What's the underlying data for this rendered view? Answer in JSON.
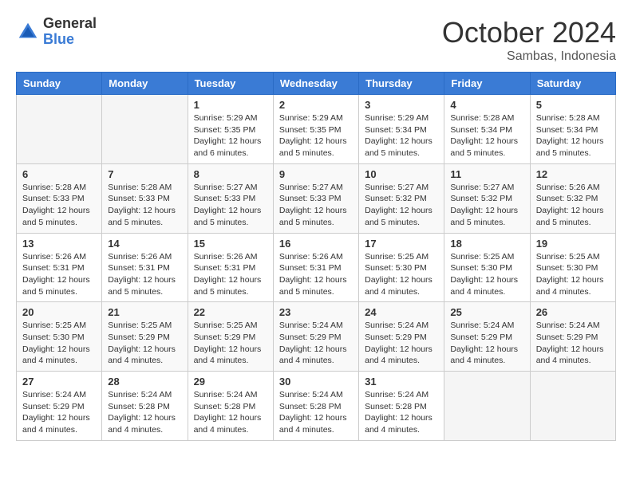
{
  "header": {
    "logo_general": "General",
    "logo_blue": "Blue",
    "month_title": "October 2024",
    "subtitle": "Sambas, Indonesia"
  },
  "days_of_week": [
    "Sunday",
    "Monday",
    "Tuesday",
    "Wednesday",
    "Thursday",
    "Friday",
    "Saturday"
  ],
  "weeks": [
    [
      {
        "day": "",
        "info": ""
      },
      {
        "day": "",
        "info": ""
      },
      {
        "day": "1",
        "info": "Sunrise: 5:29 AM\nSunset: 5:35 PM\nDaylight: 12 hours and 6 minutes."
      },
      {
        "day": "2",
        "info": "Sunrise: 5:29 AM\nSunset: 5:35 PM\nDaylight: 12 hours and 5 minutes."
      },
      {
        "day": "3",
        "info": "Sunrise: 5:29 AM\nSunset: 5:34 PM\nDaylight: 12 hours and 5 minutes."
      },
      {
        "day": "4",
        "info": "Sunrise: 5:28 AM\nSunset: 5:34 PM\nDaylight: 12 hours and 5 minutes."
      },
      {
        "day": "5",
        "info": "Sunrise: 5:28 AM\nSunset: 5:34 PM\nDaylight: 12 hours and 5 minutes."
      }
    ],
    [
      {
        "day": "6",
        "info": "Sunrise: 5:28 AM\nSunset: 5:33 PM\nDaylight: 12 hours and 5 minutes."
      },
      {
        "day": "7",
        "info": "Sunrise: 5:28 AM\nSunset: 5:33 PM\nDaylight: 12 hours and 5 minutes."
      },
      {
        "day": "8",
        "info": "Sunrise: 5:27 AM\nSunset: 5:33 PM\nDaylight: 12 hours and 5 minutes."
      },
      {
        "day": "9",
        "info": "Sunrise: 5:27 AM\nSunset: 5:33 PM\nDaylight: 12 hours and 5 minutes."
      },
      {
        "day": "10",
        "info": "Sunrise: 5:27 AM\nSunset: 5:32 PM\nDaylight: 12 hours and 5 minutes."
      },
      {
        "day": "11",
        "info": "Sunrise: 5:27 AM\nSunset: 5:32 PM\nDaylight: 12 hours and 5 minutes."
      },
      {
        "day": "12",
        "info": "Sunrise: 5:26 AM\nSunset: 5:32 PM\nDaylight: 12 hours and 5 minutes."
      }
    ],
    [
      {
        "day": "13",
        "info": "Sunrise: 5:26 AM\nSunset: 5:31 PM\nDaylight: 12 hours and 5 minutes."
      },
      {
        "day": "14",
        "info": "Sunrise: 5:26 AM\nSunset: 5:31 PM\nDaylight: 12 hours and 5 minutes."
      },
      {
        "day": "15",
        "info": "Sunrise: 5:26 AM\nSunset: 5:31 PM\nDaylight: 12 hours and 5 minutes."
      },
      {
        "day": "16",
        "info": "Sunrise: 5:26 AM\nSunset: 5:31 PM\nDaylight: 12 hours and 5 minutes."
      },
      {
        "day": "17",
        "info": "Sunrise: 5:25 AM\nSunset: 5:30 PM\nDaylight: 12 hours and 4 minutes."
      },
      {
        "day": "18",
        "info": "Sunrise: 5:25 AM\nSunset: 5:30 PM\nDaylight: 12 hours and 4 minutes."
      },
      {
        "day": "19",
        "info": "Sunrise: 5:25 AM\nSunset: 5:30 PM\nDaylight: 12 hours and 4 minutes."
      }
    ],
    [
      {
        "day": "20",
        "info": "Sunrise: 5:25 AM\nSunset: 5:30 PM\nDaylight: 12 hours and 4 minutes."
      },
      {
        "day": "21",
        "info": "Sunrise: 5:25 AM\nSunset: 5:29 PM\nDaylight: 12 hours and 4 minutes."
      },
      {
        "day": "22",
        "info": "Sunrise: 5:25 AM\nSunset: 5:29 PM\nDaylight: 12 hours and 4 minutes."
      },
      {
        "day": "23",
        "info": "Sunrise: 5:24 AM\nSunset: 5:29 PM\nDaylight: 12 hours and 4 minutes."
      },
      {
        "day": "24",
        "info": "Sunrise: 5:24 AM\nSunset: 5:29 PM\nDaylight: 12 hours and 4 minutes."
      },
      {
        "day": "25",
        "info": "Sunrise: 5:24 AM\nSunset: 5:29 PM\nDaylight: 12 hours and 4 minutes."
      },
      {
        "day": "26",
        "info": "Sunrise: 5:24 AM\nSunset: 5:29 PM\nDaylight: 12 hours and 4 minutes."
      }
    ],
    [
      {
        "day": "27",
        "info": "Sunrise: 5:24 AM\nSunset: 5:29 PM\nDaylight: 12 hours and 4 minutes."
      },
      {
        "day": "28",
        "info": "Sunrise: 5:24 AM\nSunset: 5:28 PM\nDaylight: 12 hours and 4 minutes."
      },
      {
        "day": "29",
        "info": "Sunrise: 5:24 AM\nSunset: 5:28 PM\nDaylight: 12 hours and 4 minutes."
      },
      {
        "day": "30",
        "info": "Sunrise: 5:24 AM\nSunset: 5:28 PM\nDaylight: 12 hours and 4 minutes."
      },
      {
        "day": "31",
        "info": "Sunrise: 5:24 AM\nSunset: 5:28 PM\nDaylight: 12 hours and 4 minutes."
      },
      {
        "day": "",
        "info": ""
      },
      {
        "day": "",
        "info": ""
      }
    ]
  ]
}
